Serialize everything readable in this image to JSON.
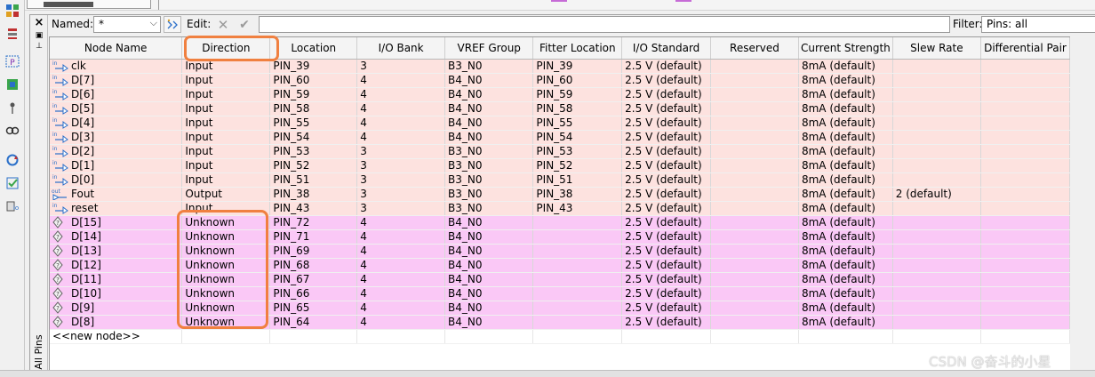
{
  "filter_bar": {
    "named_label": "Named:",
    "named_value": "*",
    "edit_label": "Edit:",
    "filter_label": "Filter:",
    "filter_value": "Pins: all"
  },
  "pane": {
    "side_label": "All Pins"
  },
  "table": {
    "columns": [
      "Node Name",
      "Direction",
      "Location",
      "I/O Bank",
      "VREF Group",
      "Fitter Location",
      "I/O Standard",
      "Reserved",
      "Current Strength",
      "Slew Rate",
      "Differential Pair"
    ],
    "rows": [
      {
        "type": "in",
        "name": "clk",
        "direction": "Input",
        "location": "PIN_39",
        "bank": "3",
        "vref": "B3_N0",
        "fitter": "PIN_39",
        "iostd": "2.5 V (default)",
        "reserved": "",
        "current": "8mA (default)",
        "slew": "",
        "diff": ""
      },
      {
        "type": "in",
        "name": "D[7]",
        "direction": "Input",
        "location": "PIN_60",
        "bank": "4",
        "vref": "B4_N0",
        "fitter": "PIN_60",
        "iostd": "2.5 V (default)",
        "reserved": "",
        "current": "8mA (default)",
        "slew": "",
        "diff": ""
      },
      {
        "type": "in",
        "name": "D[6]",
        "direction": "Input",
        "location": "PIN_59",
        "bank": "4",
        "vref": "B4_N0",
        "fitter": "PIN_59",
        "iostd": "2.5 V (default)",
        "reserved": "",
        "current": "8mA (default)",
        "slew": "",
        "diff": ""
      },
      {
        "type": "in",
        "name": "D[5]",
        "direction": "Input",
        "location": "PIN_58",
        "bank": "4",
        "vref": "B4_N0",
        "fitter": "PIN_58",
        "iostd": "2.5 V (default)",
        "reserved": "",
        "current": "8mA (default)",
        "slew": "",
        "diff": ""
      },
      {
        "type": "in",
        "name": "D[4]",
        "direction": "Input",
        "location": "PIN_55",
        "bank": "4",
        "vref": "B4_N0",
        "fitter": "PIN_55",
        "iostd": "2.5 V (default)",
        "reserved": "",
        "current": "8mA (default)",
        "slew": "",
        "diff": ""
      },
      {
        "type": "in",
        "name": "D[3]",
        "direction": "Input",
        "location": "PIN_54",
        "bank": "4",
        "vref": "B4_N0",
        "fitter": "PIN_54",
        "iostd": "2.5 V (default)",
        "reserved": "",
        "current": "8mA (default)",
        "slew": "",
        "diff": ""
      },
      {
        "type": "in",
        "name": "D[2]",
        "direction": "Input",
        "location": "PIN_53",
        "bank": "3",
        "vref": "B3_N0",
        "fitter": "PIN_53",
        "iostd": "2.5 V (default)",
        "reserved": "",
        "current": "8mA (default)",
        "slew": "",
        "diff": ""
      },
      {
        "type": "in",
        "name": "D[1]",
        "direction": "Input",
        "location": "PIN_52",
        "bank": "3",
        "vref": "B3_N0",
        "fitter": "PIN_52",
        "iostd": "2.5 V (default)",
        "reserved": "",
        "current": "8mA (default)",
        "slew": "",
        "diff": ""
      },
      {
        "type": "in",
        "name": "D[0]",
        "direction": "Input",
        "location": "PIN_51",
        "bank": "3",
        "vref": "B3_N0",
        "fitter": "PIN_51",
        "iostd": "2.5 V (default)",
        "reserved": "",
        "current": "8mA (default)",
        "slew": "",
        "diff": ""
      },
      {
        "type": "out",
        "name": "Fout",
        "direction": "Output",
        "location": "PIN_38",
        "bank": "3",
        "vref": "B3_N0",
        "fitter": "PIN_38",
        "iostd": "2.5 V (default)",
        "reserved": "",
        "current": "8mA (default)",
        "slew": "2 (default)",
        "diff": ""
      },
      {
        "type": "in",
        "name": "reset",
        "direction": "Input",
        "location": "PIN_43",
        "bank": "3",
        "vref": "B3_N0",
        "fitter": "PIN_43",
        "iostd": "2.5 V (default)",
        "reserved": "",
        "current": "8mA (default)",
        "slew": "",
        "diff": ""
      },
      {
        "type": "unk",
        "name": "D[15]",
        "direction": "Unknown",
        "location": "PIN_72",
        "bank": "4",
        "vref": "B4_N0",
        "fitter": "",
        "iostd": "2.5 V (default)",
        "reserved": "",
        "current": "8mA (default)",
        "slew": "",
        "diff": ""
      },
      {
        "type": "unk",
        "name": "D[14]",
        "direction": "Unknown",
        "location": "PIN_71",
        "bank": "4",
        "vref": "B4_N0",
        "fitter": "",
        "iostd": "2.5 V (default)",
        "reserved": "",
        "current": "8mA (default)",
        "slew": "",
        "diff": ""
      },
      {
        "type": "unk",
        "name": "D[13]",
        "direction": "Unknown",
        "location": "PIN_69",
        "bank": "4",
        "vref": "B4_N0",
        "fitter": "",
        "iostd": "2.5 V (default)",
        "reserved": "",
        "current": "8mA (default)",
        "slew": "",
        "diff": ""
      },
      {
        "type": "unk",
        "name": "D[12]",
        "direction": "Unknown",
        "location": "PIN_68",
        "bank": "4",
        "vref": "B4_N0",
        "fitter": "",
        "iostd": "2.5 V (default)",
        "reserved": "",
        "current": "8mA (default)",
        "slew": "",
        "diff": ""
      },
      {
        "type": "unk",
        "name": "D[11]",
        "direction": "Unknown",
        "location": "PIN_67",
        "bank": "4",
        "vref": "B4_N0",
        "fitter": "",
        "iostd": "2.5 V (default)",
        "reserved": "",
        "current": "8mA (default)",
        "slew": "",
        "diff": ""
      },
      {
        "type": "unk",
        "name": "D[10]",
        "direction": "Unknown",
        "location": "PIN_66",
        "bank": "4",
        "vref": "B4_N0",
        "fitter": "",
        "iostd": "2.5 V (default)",
        "reserved": "",
        "current": "8mA (default)",
        "slew": "",
        "diff": ""
      },
      {
        "type": "unk",
        "name": "D[9]",
        "direction": "Unknown",
        "location": "PIN_65",
        "bank": "4",
        "vref": "B4_N0",
        "fitter": "",
        "iostd": "2.5 V (default)",
        "reserved": "",
        "current": "8mA (default)",
        "slew": "",
        "diff": ""
      },
      {
        "type": "unk",
        "name": "D[8]",
        "direction": "Unknown",
        "location": "PIN_64",
        "bank": "4",
        "vref": "B4_N0",
        "fitter": "",
        "iostd": "2.5 V (default)",
        "reserved": "",
        "current": "8mA (default)",
        "slew": "",
        "diff": ""
      }
    ],
    "new_node_label": "<<new node>>"
  },
  "watermark": "CSDN @奋斗的小星",
  "colors": {
    "input_row": "#fde2df",
    "unassigned_row": "#fac8f6",
    "annotation": "#f08040"
  },
  "icons": {
    "input_pin": "input-pin-icon",
    "output_pin": "output-pin-icon",
    "unknown_pin": "unknown-pin-icon"
  }
}
